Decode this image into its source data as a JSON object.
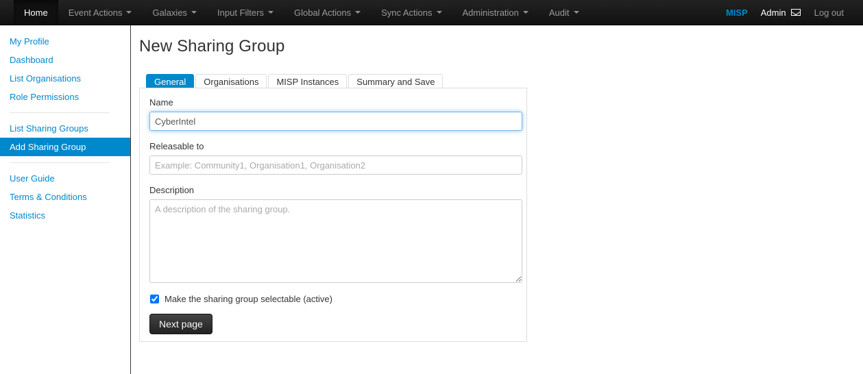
{
  "navbar": {
    "items": [
      {
        "label": "Home",
        "active": true,
        "dropdown": false
      },
      {
        "label": "Event Actions",
        "active": false,
        "dropdown": true
      },
      {
        "label": "Galaxies",
        "active": false,
        "dropdown": true
      },
      {
        "label": "Input Filters",
        "active": false,
        "dropdown": true
      },
      {
        "label": "Global Actions",
        "active": false,
        "dropdown": true
      },
      {
        "label": "Sync Actions",
        "active": false,
        "dropdown": true
      },
      {
        "label": "Administration",
        "active": false,
        "dropdown": true
      },
      {
        "label": "Audit",
        "active": false,
        "dropdown": true
      }
    ],
    "brand": "MISP",
    "user": "Admin",
    "message_icon": "envelope-icon",
    "logout": "Log out",
    "background": "#1b1b1b",
    "brand_color": "#0088cc"
  },
  "sidebar": {
    "groups": [
      {
        "items": [
          {
            "label": "My Profile",
            "active": false
          },
          {
            "label": "Dashboard",
            "active": false
          },
          {
            "label": "List Organisations",
            "active": false
          },
          {
            "label": "Role Permissions",
            "active": false
          }
        ]
      },
      {
        "items": [
          {
            "label": "List Sharing Groups",
            "active": false
          },
          {
            "label": "Add Sharing Group",
            "active": true
          }
        ]
      },
      {
        "items": [
          {
            "label": "User Guide",
            "active": false
          },
          {
            "label": "Terms & Conditions",
            "active": false
          },
          {
            "label": "Statistics",
            "active": false
          }
        ]
      }
    ],
    "link_color": "#0088cc",
    "active_background": "#0088cc"
  },
  "main": {
    "page_title": "New Sharing Group",
    "tabs": [
      {
        "label": "General",
        "active": true
      },
      {
        "label": "Organisations",
        "active": false
      },
      {
        "label": "MISP Instances",
        "active": false
      },
      {
        "label": "Summary and Save",
        "active": false
      }
    ],
    "form": {
      "name": {
        "label": "Name",
        "value": "CyberIntel",
        "placeholder": "",
        "focused": true
      },
      "releasable_to": {
        "label": "Releasable to",
        "value": "",
        "placeholder": "Example: Community1, Organisation1, Organisation2"
      },
      "description": {
        "label": "Description",
        "value": "",
        "placeholder": "A description of the sharing group."
      },
      "active_checkbox": {
        "label": "Make the sharing group selectable (active)",
        "checked": true
      },
      "submit_label": "Next page"
    }
  }
}
